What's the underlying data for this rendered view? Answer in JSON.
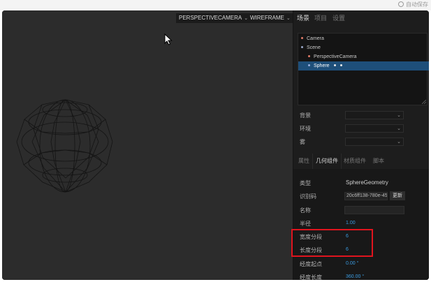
{
  "top_bar": {
    "label": "自动保存"
  },
  "viewport": {
    "camera_select": "PERSPECTIVECAMERA",
    "shading_select": "WIREFRAME"
  },
  "sidebar": {
    "tabs": [
      {
        "label": "场景",
        "active": true
      },
      {
        "label": "项目",
        "active": false
      },
      {
        "label": "设置",
        "active": false
      }
    ],
    "outliner": [
      {
        "label": "Camera",
        "color": "#e07a66",
        "indent": 0,
        "selected": false
      },
      {
        "label": "Scene",
        "color": "#9aa8c8",
        "indent": 0,
        "selected": false
      },
      {
        "label": "PerspectiveCamera",
        "color": "#e07a66",
        "indent": 1,
        "selected": false
      },
      {
        "label": "Sphere",
        "color": "#9ab0e0",
        "indent": 1,
        "selected": true
      }
    ],
    "scene_props": {
      "background_label": "背景",
      "environment_label": "环境",
      "fog_label": "雾"
    },
    "subtabs": [
      {
        "label": "属性",
        "active": false
      },
      {
        "label": "几何组件",
        "active": true
      },
      {
        "label": "材质组件",
        "active": false
      },
      {
        "label": "脚本",
        "active": false
      }
    ],
    "geometry": {
      "type_label": "类型",
      "type_value": "SphereGeometry",
      "uuid_label": "识别码",
      "uuid_value": "20c6ff138-780e-45f",
      "uuid_button": "更新",
      "name_label": "名称",
      "name_value": "",
      "radius_label": "半径",
      "radius_value": "1.00",
      "width_segments_label": "宽度分段",
      "width_segments_value": "6",
      "height_segments_label": "长度分段",
      "height_segments_value": "6",
      "phi_start_label": "经度起点",
      "phi_start_value": "0.00 °",
      "phi_length_label": "经度长度",
      "phi_length_value": "360.00 °"
    }
  },
  "colors": {
    "highlight": "#e0141e",
    "accent_number": "#3a9be0",
    "selected_row": "#1e4f7a"
  }
}
